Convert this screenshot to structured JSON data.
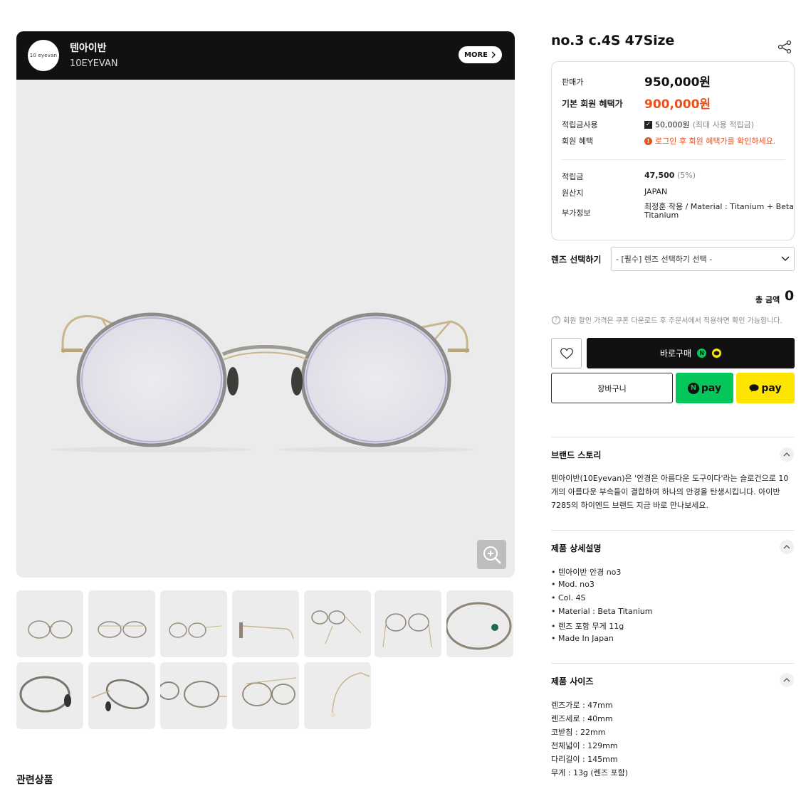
{
  "brand": {
    "logo_text": "10 eyevan",
    "name_kr": "텐아이반",
    "name_en": "10EYEVAN",
    "more_label": "MORE"
  },
  "product": {
    "title": "no.3 c.4S 47Size"
  },
  "info": {
    "sale_price_label": "판매가",
    "sale_price": "950,000원",
    "member_price_label": "기본 회원 혜택가",
    "member_price": "900,000원",
    "points_use_label": "적립금사용",
    "points_use_value": "50,000원",
    "points_use_note": "(최대 사용 적립금)",
    "member_benefit_label": "회원 혜택",
    "member_benefit_alert": "로그인 후 회원 혜택가를 확인하세요.",
    "reward_label": "적립금",
    "reward_value": "47,500",
    "reward_pct": "(5%)",
    "origin_label": "원산지",
    "origin_value": "JAPAN",
    "extra_label": "부가정보",
    "extra_value_line1": "최정훈 착용 / Material : Titanium + Beta",
    "extra_value_line2": "Titanium"
  },
  "lens": {
    "label": "렌즈 선택하기",
    "selected": "- [필수] 렌즈 선택하기 선택 -"
  },
  "total": {
    "label": "총 금액",
    "value": "0"
  },
  "notice": "회원 할인 가격은 쿠폰 다운로드 후 주문서에서 적용하면 확인 가능합니다.",
  "buttons": {
    "buy": "바로구매",
    "cart": "장바구니",
    "npay": "pay",
    "kpay": "pay"
  },
  "sections": {
    "story_title": "브랜드 스토리",
    "story_text": "텐아이반(10Eyevan)은 '안경은 아름다운 도구이다'라는 슬로건으로 10개의 아름다운 부속들이 결합하여 하나의 안경을 탄생시킵니다. 아이반 7285의 하이엔드 브랜드 지금 바로 만나보세요.",
    "detail_title": "제품 상세설명",
    "detail_items": [
      "• 텐아이반 안경 no3",
      "• Mod. no3",
      "• Col. 4S",
      "• Material : Beta Titanium",
      "• 렌즈 포함 무게 11g",
      "• Made In Japan"
    ],
    "size_title": "제품 사이즈",
    "size_items": [
      "렌즈가로 : 47mm",
      "렌즈세로 : 40mm",
      "코받침 : 22mm",
      "전체넓이 : 129mm",
      "다리길이 : 145mm",
      "무게 : 13g (렌즈 포함)"
    ]
  },
  "related_title": "관련상품",
  "colors": {
    "accent_orange": "#e8501e",
    "npay_green": "#03c75a",
    "kakao_yellow": "#fee500"
  }
}
